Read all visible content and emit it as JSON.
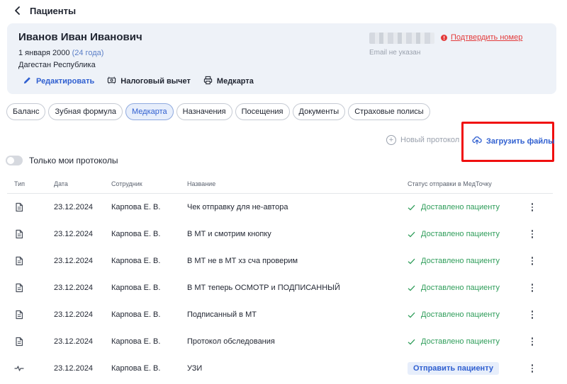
{
  "header": {
    "title": "Пациенты"
  },
  "patient": {
    "name": "Иванов Иван Иванович",
    "dob": "1 января 2000",
    "age": "(24 года)",
    "region": "Дагестан Республика",
    "confirm_phone": "Подтвердить номер",
    "email": "Email не указан"
  },
  "actions": {
    "edit": "Редактировать",
    "tax": "Налоговый вычет",
    "medcard": "Медкарта"
  },
  "tabs": [
    "Баланс",
    "Зубная формула",
    "Медкарта",
    "Назначения",
    "Посещения",
    "Документы",
    "Страховые полисы"
  ],
  "active_tab": "Медкарта",
  "toolbar": {
    "new_protocol": "Новый протокол",
    "upload": "Загрузить файлы",
    "only_mine": "Только мои протоколы"
  },
  "table": {
    "columns": {
      "type": "Тип",
      "date": "Дата",
      "employee": "Сотрудник",
      "title": "Название",
      "status": "Статус отправки в МедТочку"
    },
    "rows": [
      {
        "icon": "document-icon",
        "date": "23.12.2024",
        "employee": "Карпова Е. В.",
        "title": "Чек отправку для не-автора",
        "status": "Доставлено пациенту"
      },
      {
        "icon": "document-icon",
        "date": "23.12.2024",
        "employee": "Карпова Е. В.",
        "title": "В МТ и смотрим кнопку",
        "status": "Доставлено пациенту"
      },
      {
        "icon": "document-icon",
        "date": "23.12.2024",
        "employee": "Карпова Е. В.",
        "title": "В МТ не в МТ хз сча проверим",
        "status": "Доставлено пациенту"
      },
      {
        "icon": "document-icon",
        "date": "23.12.2024",
        "employee": "Карпова Е. В.",
        "title": "В МТ теперь ОСМОТР и ПОДПИСАННЫЙ",
        "status": "Доставлено пациенту"
      },
      {
        "icon": "document-icon",
        "date": "23.12.2024",
        "employee": "Карпова Е. В.",
        "title": "Подписанный в МТ",
        "status": "Доставлено пациенту"
      },
      {
        "icon": "document-icon",
        "date": "23.12.2024",
        "employee": "Карпова Е. В.",
        "title": "Протокол обследования",
        "status": "Доставлено пациенту"
      },
      {
        "icon": "waveform-icon",
        "date": "23.12.2024",
        "employee": "Карпова Е. В.",
        "title": "УЗИ",
        "send": "Отправить пациенту"
      }
    ]
  },
  "colors": {
    "accent": "#2f5fd0",
    "success": "#2f9d5a",
    "danger": "#e33b3b",
    "highlight": "#f00f0f",
    "card_bg": "#eef2f8"
  }
}
